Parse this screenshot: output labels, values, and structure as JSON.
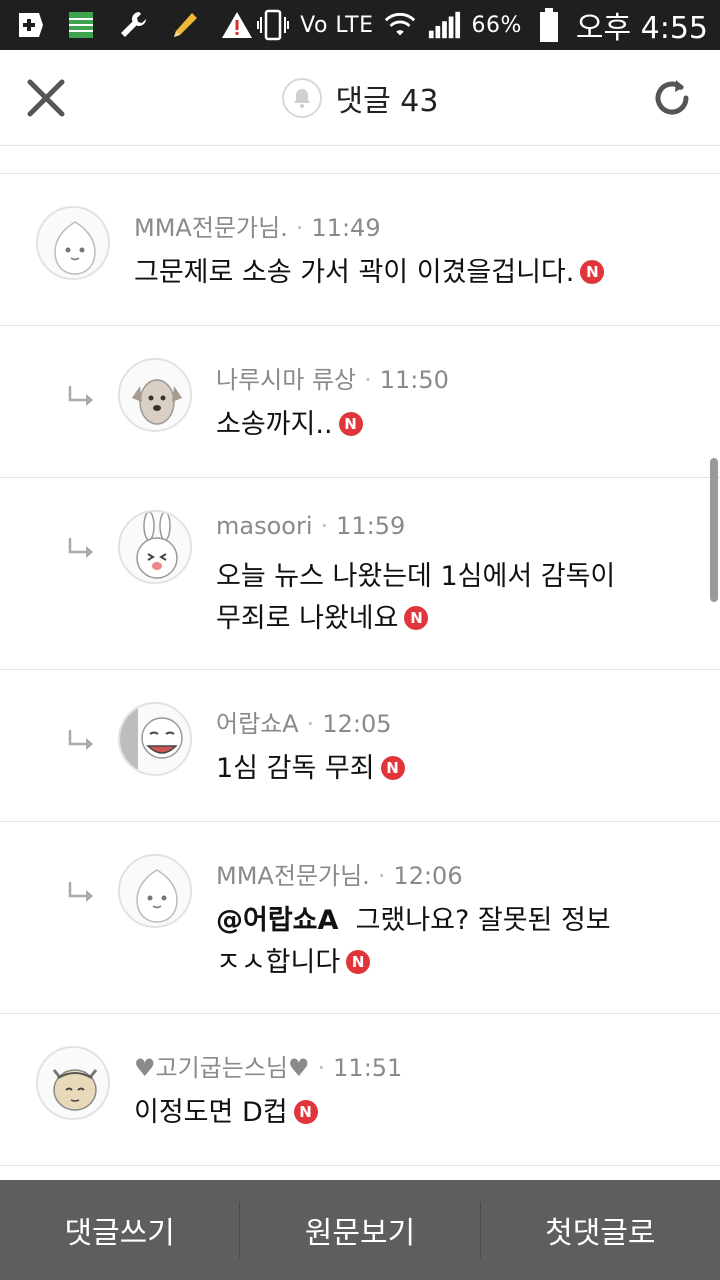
{
  "status_bar": {
    "lte_label": "Vo LTE",
    "battery": "66%",
    "time": "오후 4:55"
  },
  "header": {
    "title": "댓글 43"
  },
  "comments": [
    {
      "author": "MMA전문가님.",
      "time": "11:49",
      "text": "그문제로 소송 가서 곽이 이겼을겁니다.",
      "reply": false,
      "avatar": "peach-character"
    },
    {
      "author": "나루시마 류상",
      "time": "11:50",
      "text": "소송까지..",
      "reply": true,
      "avatar": "dog-character"
    },
    {
      "author": "masoori",
      "time": "11:59",
      "text_lines": [
        "오늘 뉴스 나왔는데 1심에서 감독이",
        "무죄로 나왔네요"
      ],
      "reply": true,
      "avatar": "rabbit-character"
    },
    {
      "author": "어랍쇼A",
      "time": "12:05",
      "text": "1심 감독 무죄",
      "reply": true,
      "avatar": "laughing-character"
    },
    {
      "author": "MMA전문가님.",
      "time": "12:06",
      "mention": "@어랍쇼A",
      "text_lines": [
        "그랬나요? 잘못된 정보",
        "ㅈㅅ합니다"
      ],
      "reply": true,
      "avatar": "peach-character"
    },
    {
      "author": "♥고기굽는스님♥",
      "time": "11:51",
      "text": "이정도면 D컵",
      "reply": false,
      "avatar": "cat-character"
    }
  ],
  "badge_label": "N",
  "bottom_bar": {
    "write": "댓글쓰기",
    "original": "원문보기",
    "first": "첫댓글로"
  },
  "colors": {
    "status_bar": "#1f1f1f",
    "badge": "#e0353a",
    "bottom_bar": "#5e5e5e",
    "meta_text": "#8a8a8a"
  }
}
